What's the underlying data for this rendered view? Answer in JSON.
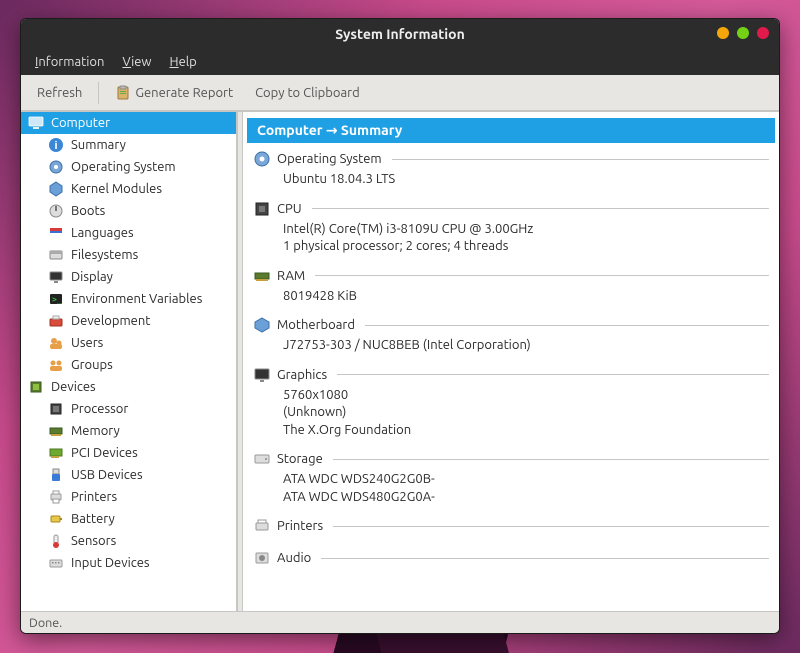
{
  "window": {
    "title": "System Information"
  },
  "menubar": {
    "information": "Information",
    "view": "View",
    "help": "Help"
  },
  "toolbar": {
    "refresh": "Refresh",
    "generate_report": "Generate Report",
    "copy_clipboard": "Copy to Clipboard"
  },
  "sidebar": {
    "computer": {
      "label": "Computer",
      "items": [
        "Summary",
        "Operating System",
        "Kernel Modules",
        "Boots",
        "Languages",
        "Filesystems",
        "Display",
        "Environment Variables",
        "Development",
        "Users",
        "Groups"
      ]
    },
    "devices": {
      "label": "Devices",
      "items": [
        "Processor",
        "Memory",
        "PCI Devices",
        "USB Devices",
        "Printers",
        "Battery",
        "Sensors",
        "Input Devices"
      ]
    }
  },
  "breadcrumb": "Computer → Summary",
  "summary": {
    "os": {
      "title": "Operating System",
      "lines": [
        "Ubuntu 18.04.3 LTS"
      ]
    },
    "cpu": {
      "title": "CPU",
      "lines": [
        "Intel(R) Core(TM) i3-8109U CPU @ 3.00GHz",
        "1 physical processor; 2 cores; 4 threads"
      ]
    },
    "ram": {
      "title": "RAM",
      "lines": [
        "8019428 KiB"
      ]
    },
    "mobo": {
      "title": "Motherboard",
      "lines": [
        "J72753-303 / NUC8BEB (Intel Corporation)"
      ]
    },
    "graphics": {
      "title": "Graphics",
      "lines": [
        "5760x1080",
        "(Unknown)",
        "The X.Org Foundation"
      ]
    },
    "storage": {
      "title": "Storage",
      "lines": [
        "ATA WDC WDS240G2G0B-",
        "ATA WDC WDS480G2G0A-"
      ]
    },
    "printers": {
      "title": "Printers",
      "lines": []
    },
    "audio": {
      "title": "Audio",
      "lines": []
    }
  },
  "status": "Done."
}
